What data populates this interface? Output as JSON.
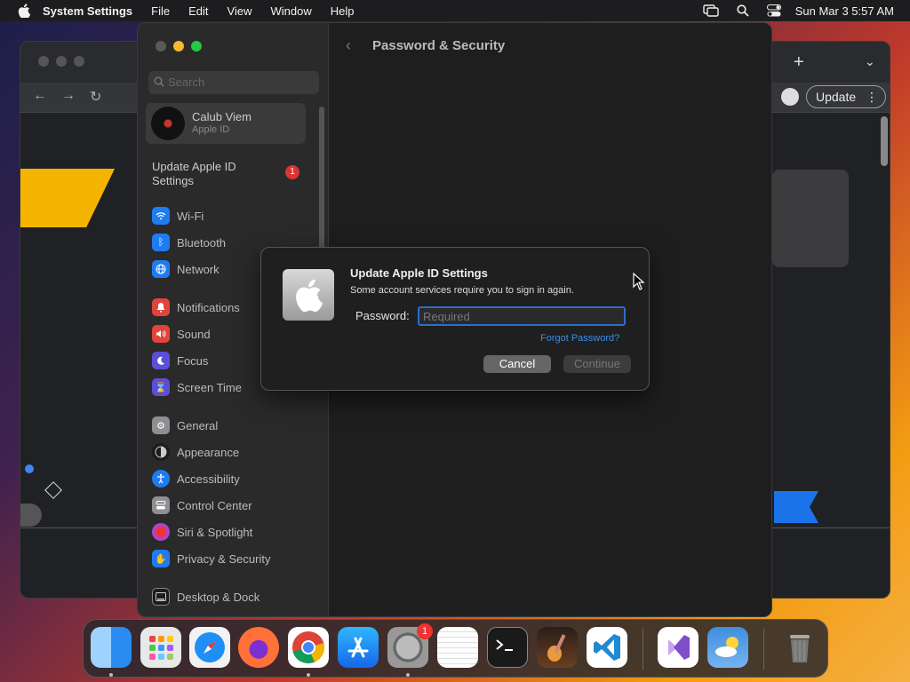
{
  "menubar": {
    "app_name": "System Settings",
    "menus": [
      "File",
      "Edit",
      "View",
      "Window",
      "Help"
    ],
    "clock": "Sun Mar 3  5:57 AM"
  },
  "chrome": {
    "update_label": "Update",
    "menu_dots": "⋮",
    "new_tab": "+",
    "tab_list": "⌄"
  },
  "settings": {
    "search_placeholder": "Search",
    "account": {
      "name": "Calub Viem",
      "subtitle": "Apple ID"
    },
    "update_row": {
      "label": "Update Apple ID Settings",
      "badge": "1"
    },
    "items": [
      {
        "label": "Wi-Fi",
        "color": "#1e7cf2",
        "icon": "wifi-icon"
      },
      {
        "label": "Bluetooth",
        "color": "#1e7cf2",
        "icon": "bluetooth-icon"
      },
      {
        "label": "Network",
        "color": "#1e7cf2",
        "icon": "globe-icon"
      },
      {
        "label": "Notifications",
        "color": "#e0443a",
        "icon": "bell-icon"
      },
      {
        "label": "Sound",
        "color": "#e0443a",
        "icon": "speaker-icon"
      },
      {
        "label": "Focus",
        "color": "#5b4fd6",
        "icon": "moon-icon"
      },
      {
        "label": "Screen Time",
        "color": "#5b4fd6",
        "icon": "hourglass-icon"
      },
      {
        "label": "General",
        "color": "#8e8e93",
        "icon": "gear-icon"
      },
      {
        "label": "Appearance",
        "color": "#1c1c1e",
        "icon": "appearance-icon"
      },
      {
        "label": "Accessibility",
        "color": "#1e7cf2",
        "icon": "accessibility-icon"
      },
      {
        "label": "Control Center",
        "color": "#8e8e93",
        "icon": "control-center-icon"
      },
      {
        "label": "Siri & Spotlight",
        "color": "#b044d8",
        "icon": "siri-icon"
      },
      {
        "label": "Privacy & Security",
        "color": "#1e7cf2",
        "icon": "hand-icon"
      },
      {
        "label": "Desktop & Dock",
        "color": "#1c1c1e",
        "icon": "dock-icon"
      }
    ],
    "content_title": "Password & Security"
  },
  "dialog": {
    "title": "Update Apple ID Settings",
    "message": "Some account services require you to sign in again.",
    "password_label": "Password:",
    "password_placeholder": "Required",
    "password_value": "",
    "forgot_label": "Forgot Password?",
    "cancel_label": "Cancel",
    "continue_label": "Continue"
  },
  "dock": {
    "apps": [
      {
        "name": "finder",
        "color": "#2a8cf0"
      },
      {
        "name": "launchpad",
        "color": "#e8e8e8"
      },
      {
        "name": "safari",
        "color": "#f2f2f2"
      },
      {
        "name": "firefox",
        "color": "#ff7139"
      },
      {
        "name": "chrome",
        "color": "#ffffff"
      },
      {
        "name": "app-store",
        "color": "#1f8ff5"
      },
      {
        "name": "system-settings",
        "color": "#8e8e93"
      },
      {
        "name": "textedit",
        "color": "#f5f5f5"
      },
      {
        "name": "terminal",
        "color": "#1a1a1a"
      },
      {
        "name": "garageband",
        "color": "#e08a2c"
      },
      {
        "name": "vscode",
        "color": "#ffffff"
      },
      {
        "name": "visual-studio",
        "color": "#ffffff"
      },
      {
        "name": "weather",
        "color": "#3f8ede"
      },
      {
        "name": "trash",
        "color": "#777777"
      }
    ],
    "settings_badge": "1"
  }
}
